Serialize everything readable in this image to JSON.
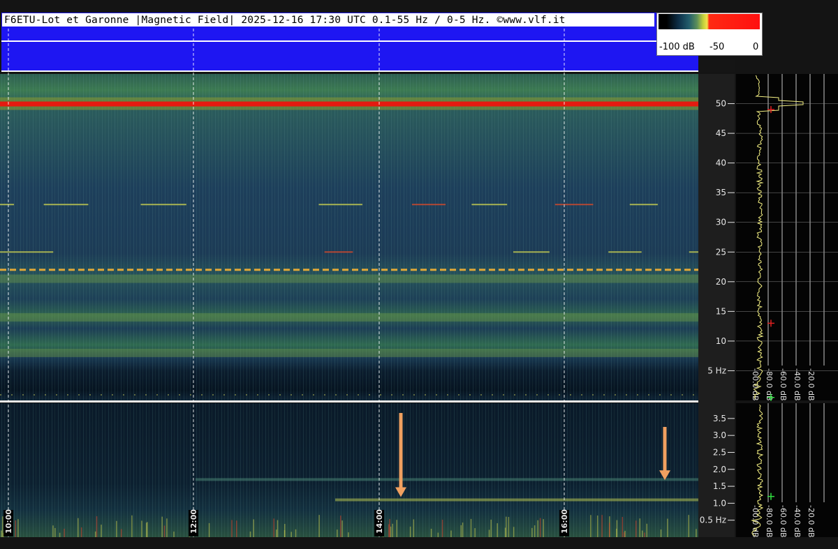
{
  "header": {
    "title": "F6ETU-Lot et Garonne |Magnetic Field| 2025-12-16 17:30 UTC 0.1-55 Hz / 0-5 Hz. ©www.vlf.it"
  },
  "colors": {
    "header_blue": "#1e16f2",
    "background": "#141414",
    "spectrum_trace": "#f4f083",
    "marker_red": "#e02020",
    "marker_green": "#30e040",
    "arrow": "#f0a060"
  },
  "color_scale": {
    "labels": [
      "-100 dB",
      "-50",
      "0"
    ]
  },
  "time_axis": {
    "labels": [
      "10:00",
      "12:00",
      "14:00",
      "16:00"
    ]
  },
  "chart_data": [
    {
      "type": "heatmap",
      "name": "0.1-55 Hz spectrogram",
      "title": "",
      "xlabel": "",
      "ylabel": "",
      "x_ticks": [
        "10:00",
        "12:00",
        "14:00",
        "16:00"
      ],
      "y_ticks": [
        {
          "value": 50,
          "label": "50"
        },
        {
          "value": 45,
          "label": "45"
        },
        {
          "value": 40,
          "label": "40"
        },
        {
          "value": 35,
          "label": "35"
        },
        {
          "value": 30,
          "label": "30"
        },
        {
          "value": 25,
          "label": "25"
        },
        {
          "value": 20,
          "label": "20"
        },
        {
          "value": 15,
          "label": "15"
        },
        {
          "value": 10,
          "label": "10"
        },
        {
          "value": 5,
          "label": "5 Hz"
        }
      ],
      "ylim": [
        0,
        55
      ],
      "color_scale_db": [
        -100,
        0
      ],
      "visible_bands_hz": [
        {
          "freq": 50,
          "kind": "mains line",
          "color": "red"
        },
        {
          "freq": 22,
          "kind": "dashed line",
          "color": "orange"
        },
        {
          "freq": 33,
          "kind": "intermittent line"
        },
        {
          "freq": 25,
          "kind": "intermittent line"
        },
        {
          "freq": 20.5,
          "kind": "Schumann band"
        },
        {
          "freq": 14,
          "kind": "Schumann band"
        },
        {
          "freq": 8,
          "kind": "Schumann band"
        }
      ]
    },
    {
      "type": "line",
      "name": "0.1-55 Hz spectrum",
      "x_ticks": [
        "-00.0 dB",
        "-80.0 dB",
        "-60.0 dB",
        "-40.0 dB",
        "-20.0 dB"
      ],
      "ylim": [
        0,
        55
      ],
      "peak_freq": 50,
      "markers": [
        {
          "freq": 49,
          "color": "red"
        },
        {
          "freq": 13,
          "color": "red"
        },
        {
          "freq": 0.5,
          "color": "green"
        }
      ]
    },
    {
      "type": "heatmap",
      "name": "0-5 Hz spectrogram",
      "x_ticks": [
        "10:00",
        "12:00",
        "14:00",
        "16:00"
      ],
      "y_ticks": [
        {
          "value": 3.5,
          "label": "3.5"
        },
        {
          "value": 3.0,
          "label": "3.0"
        },
        {
          "value": 2.5,
          "label": "2.5"
        },
        {
          "value": 2.0,
          "label": "2.0"
        },
        {
          "value": 1.5,
          "label": "1.5"
        },
        {
          "value": 1.0,
          "label": "1.0"
        },
        {
          "value": 0.5,
          "label": "0.5 Hz"
        }
      ],
      "ylim": [
        0,
        3.95
      ],
      "color_scale_db": [
        -100,
        0
      ],
      "visible_bands_hz": [
        {
          "freq": 1.1,
          "kind": "Pc1 band"
        },
        {
          "freq": 1.7,
          "kind": "Pc1 band"
        }
      ],
      "arrows": [
        {
          "time": "14:20",
          "points_to_freq": 1.1
        },
        {
          "time": "17:40",
          "points_to_freq": 1.6
        }
      ]
    },
    {
      "type": "line",
      "name": "0-5 Hz spectrum",
      "x_ticks": [
        "-00.0 dB",
        "-80.0 dB",
        "-60.0 dB",
        "-40.0 dB",
        "-20.0 dB"
      ],
      "ylim": [
        0,
        3.95
      ],
      "markers": [
        {
          "freq": 1.2,
          "color": "green"
        }
      ]
    }
  ]
}
